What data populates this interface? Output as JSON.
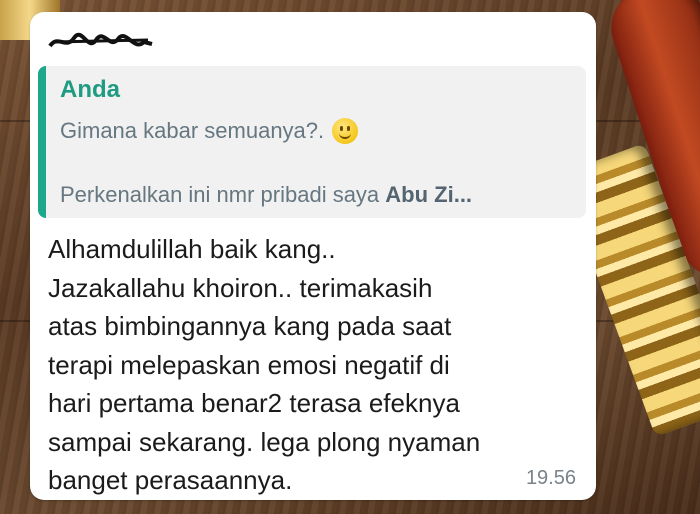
{
  "chat": {
    "sender_redacted": "",
    "quote": {
      "author": "Anda",
      "line1": "Gimana kabar semuanya?.",
      "emoji": "smiling-face-icon",
      "line2_prefix": "Perkenalkan ini nmr pribadi saya ",
      "line2_bold": "Abu Zi..."
    },
    "message_lines": [
      "Alhamdulillah baik kang..",
      "Jazakallahu khoiron.. terimakasih",
      "atas bimbingannya kang pada saat",
      "terapi melepaskan emosi negatif di",
      "hari pertama benar2 terasa efeknya",
      "sampai sekarang. lega plong nyaman",
      "banget perasaannya."
    ],
    "time": "19.56"
  },
  "colors": {
    "accent": "#1fa78b",
    "bubble": "#ffffff",
    "quote_bg": "#f0f1f0"
  }
}
